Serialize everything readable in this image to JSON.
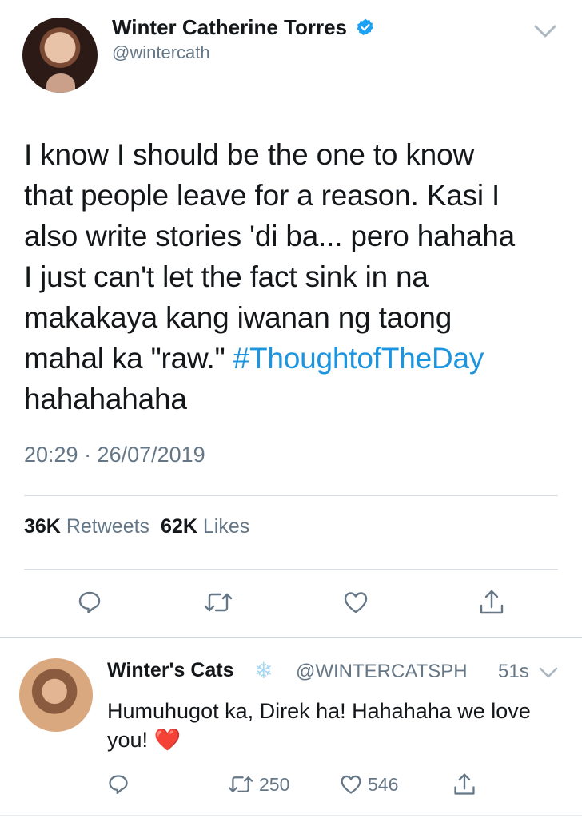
{
  "main_tweet": {
    "author_name": "Winter Catherine Torres",
    "author_handle": "@wintercath",
    "text_lines": [
      "I know I should be the one to know",
      "that people leave for a reason. Kasi I",
      "also write stories 'di ba... pero hahaha",
      "I just can't let the fact sink in na",
      "makakaya kang iwanan ng taong",
      "mahal ka \"raw.\" "
    ],
    "hashtag": "#ThoughtofTheDay",
    "text_tail": "hahahahaha",
    "timestamp": "20:29 · 26/07/2019",
    "retweets_count": "36K",
    "retweets_label": "Retweets",
    "likes_count": "62K",
    "likes_label": "Likes"
  },
  "reply": {
    "author_name": "Winter's Cats",
    "author_handle": "@WINTERCATSPH",
    "time_ago": "51s",
    "text": "Humuhugot ka, Direk ha! Hahahaha we love you!",
    "emoji": "❤️",
    "retweet_count": "250",
    "like_count": "546"
  },
  "colors": {
    "link": "#1b95e0",
    "secondary_text": "#657786",
    "primary_text": "#14171a",
    "verified": "#1da1f2",
    "heart": "#e0245e"
  },
  "icons": [
    "verified-badge-icon",
    "chevron-down-icon",
    "reply-icon",
    "retweet-icon",
    "like-icon",
    "share-icon",
    "snowflake-icon"
  ]
}
